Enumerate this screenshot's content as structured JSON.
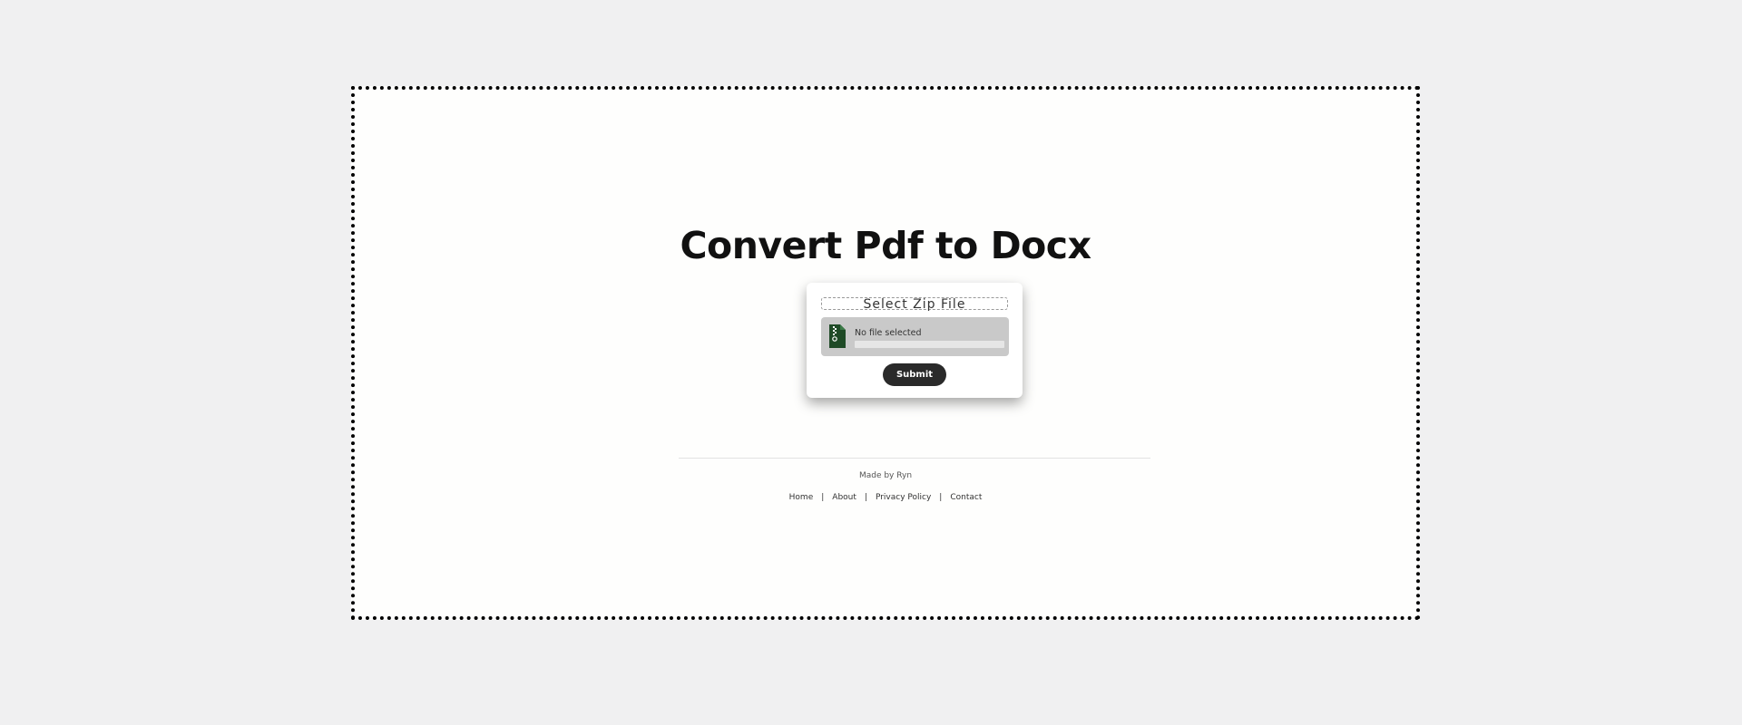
{
  "page": {
    "title": "Convert Pdf to Docx"
  },
  "upload_card": {
    "select_label": "Select Zip File",
    "file_icon": "zip-file-icon",
    "file_status": "No file selected",
    "upload_progress_percent": 0,
    "submit_label": "Submit"
  },
  "footer": {
    "made_by": "Made by Ryn",
    "links": [
      "Home",
      "About",
      "Privacy Policy",
      "Contact"
    ],
    "separator": "|"
  },
  "colors": {
    "page_background": "#f0f0f1",
    "frame_background": "#fefefd",
    "submit_button": "#2a2a2a",
    "file_box": "#c9c9c9",
    "zip_icon": "#1e4a26"
  }
}
